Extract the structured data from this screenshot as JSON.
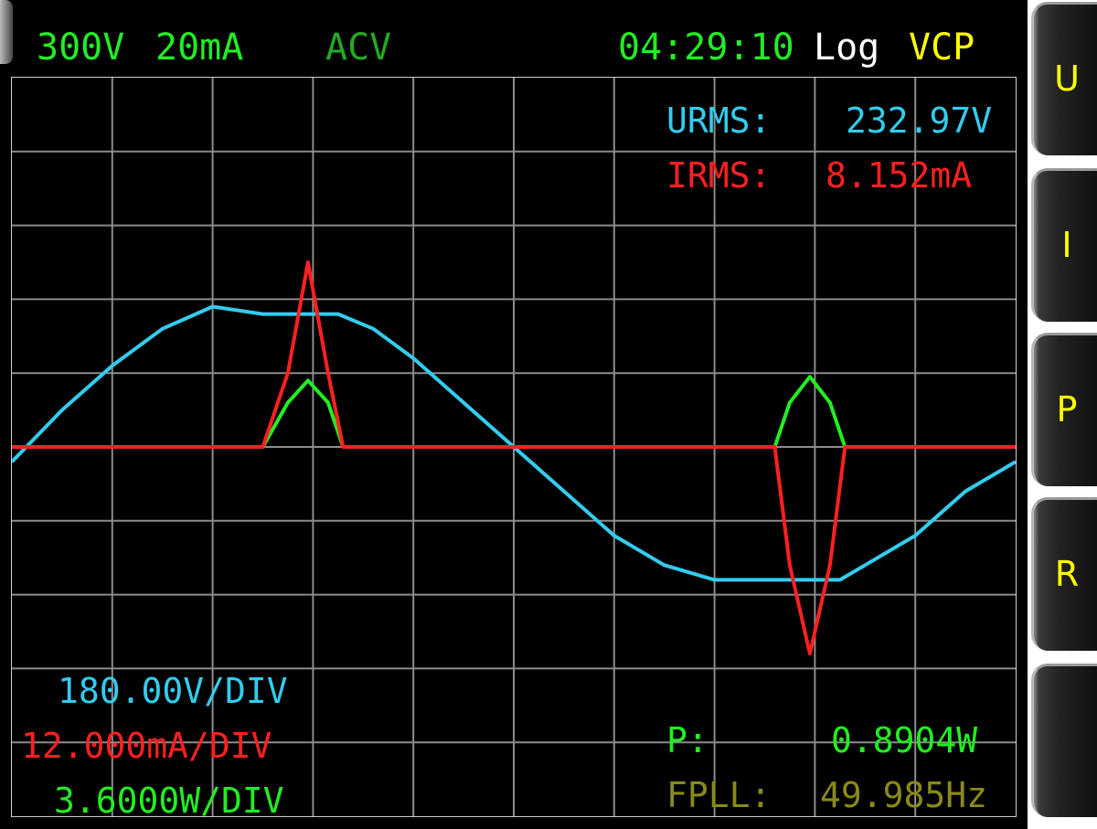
{
  "header": {
    "voltage_range": "300V",
    "current_range": "20mA",
    "mode": "ACV",
    "time": "04:29:10",
    "log": "Log",
    "vcp": "VCP"
  },
  "readings": {
    "urms_label": "URMS:",
    "urms_value": "232.97V",
    "irms_label": "IRMS:",
    "irms_value": "8.152mA",
    "p_label": "P:",
    "p_value": "0.8904W",
    "fpll_label": "FPLL:",
    "fpll_value": "49.985Hz"
  },
  "scales": {
    "voltage_div": "180.00V/DIV",
    "current_div": "12.000mA/DIV",
    "power_div": "3.6000W/DIV"
  },
  "softkeys": [
    {
      "label": "U"
    },
    {
      "label": "I"
    },
    {
      "label": "P"
    },
    {
      "label": "R"
    },
    {
      "label": ""
    }
  ],
  "colors": {
    "voltage": "#33ccee",
    "current": "#ff2020",
    "power": "#22ee22",
    "mode": "#22aa22",
    "fpll": "#8a8a1a",
    "vcp": "#ffff00",
    "grid": "#8c8c8c"
  },
  "chart_data": {
    "type": "line",
    "xdiv": 10,
    "ydiv": 10,
    "series": [
      {
        "key": "voltage",
        "unit_per_div": "180.00V/DIV",
        "x": [
          0,
          0.5,
          1.0,
          1.5,
          2.0,
          2.5,
          3.0,
          3.25,
          3.6,
          4.0,
          4.5,
          5.0,
          5.5,
          6.0,
          6.5,
          7.0,
          7.25,
          7.7,
          8.25,
          8.5,
          9.0,
          9.5,
          10.0
        ],
        "y": [
          -0.2,
          0.5,
          1.1,
          1.6,
          1.9,
          1.8,
          1.8,
          1.8,
          1.6,
          1.2,
          0.6,
          0.0,
          -0.6,
          -1.2,
          -1.6,
          -1.8,
          -1.8,
          -1.8,
          -1.8,
          -1.6,
          -1.2,
          -0.6,
          -0.2
        ]
      },
      {
        "key": "current",
        "unit_per_div": "12.000mA/DIV",
        "x": [
          0,
          2.5,
          2.75,
          2.95,
          3.15,
          3.3,
          10.0,
          7.6,
          7.75,
          7.95,
          8.15,
          8.3,
          10.0
        ],
        "y": [
          0,
          0,
          1.0,
          2.5,
          1.0,
          0,
          0,
          0,
          -1.6,
          -2.8,
          -1.6,
          0,
          0
        ],
        "segments": [
          [
            0,
            2.5,
            2.75,
            2.95,
            3.15,
            3.3,
            7.6,
            7.75,
            7.95,
            8.15,
            8.3,
            10.0
          ],
          [
            0,
            0,
            1.0,
            2.5,
            1.0,
            0,
            0,
            -1.6,
            -2.8,
            -1.6,
            0,
            0
          ]
        ]
      },
      {
        "key": "power",
        "unit_per_div": "3.6000W/DIV",
        "x": [
          0,
          2.5,
          2.75,
          2.95,
          3.15,
          3.3,
          7.6,
          7.75,
          7.95,
          8.15,
          8.3,
          10.0
        ],
        "y": [
          0,
          0,
          0.6,
          0.9,
          0.6,
          0,
          0,
          0.6,
          0.95,
          0.6,
          0,
          0
        ]
      }
    ]
  }
}
